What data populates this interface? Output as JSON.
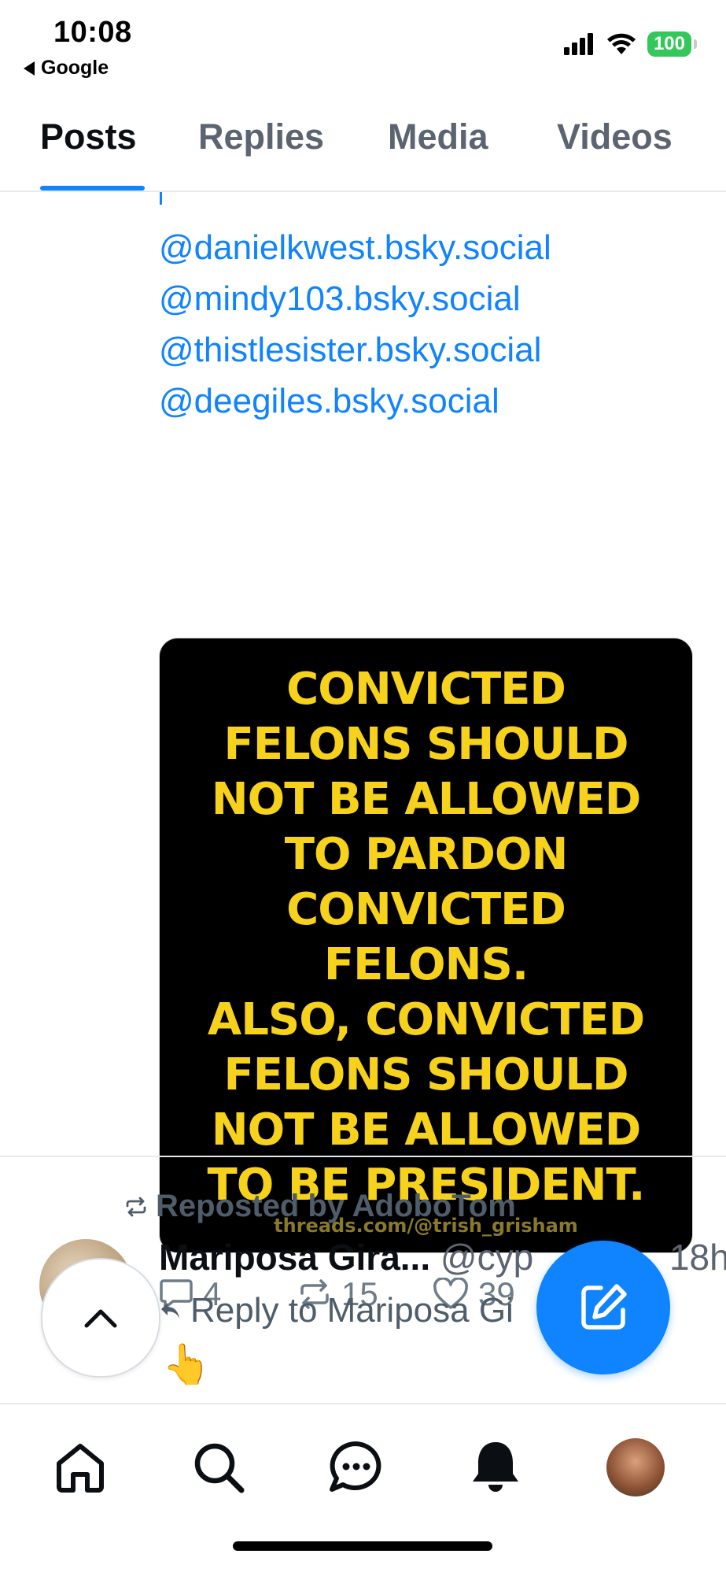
{
  "status_bar": {
    "time": "10:08",
    "back_app": "Google",
    "battery": "100"
  },
  "tabs": [
    {
      "label": "Posts",
      "active": true
    },
    {
      "label": "Replies",
      "active": false
    },
    {
      "label": "Media",
      "active": false
    },
    {
      "label": "Videos",
      "active": false
    }
  ],
  "post": {
    "mentions": [
      "@danielkwest.bsky.social",
      "@mindy103.bsky.social",
      "@thistlesister.bsky.social",
      "@deegiles.bsky.social"
    ],
    "image": {
      "lines": [
        "CONVICTED",
        "FELONS SHOULD",
        "NOT BE ALLOWED",
        "TO PARDON",
        "CONVICTED",
        "FELONS.",
        "ALSO, CONVICTED",
        "FELONS SHOULD",
        "NOT BE ALLOWED",
        "TO BE PRESIDENT."
      ],
      "credit": "threads.com/@trish_grisham"
    },
    "actions": {
      "replies": "4",
      "reposts": "15",
      "likes": "39"
    }
  },
  "next_post": {
    "repost_label": "Reposted by AdoboTom",
    "author_name": "Mariposa Gira...",
    "author_handle": "@cyp",
    "time_ago": "18h",
    "reply_to": "Reply to Mariposa Gi",
    "emoji": "👆"
  },
  "colors": {
    "accent": "#1083fe",
    "image_text": "#f7d21c",
    "muted": "#6e7b88"
  }
}
